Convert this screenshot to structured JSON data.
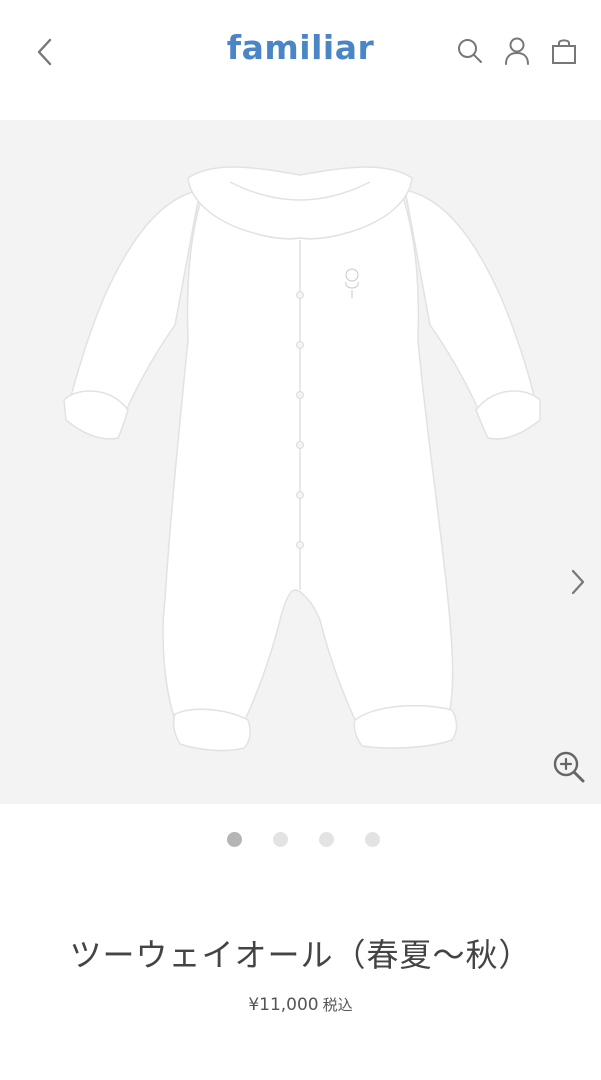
{
  "header": {
    "logo": "familiar",
    "icons": [
      "chevron-left-icon",
      "search-icon",
      "account-icon",
      "shopping-bag-icon"
    ]
  },
  "gallery": {
    "image_alt": "白いツーウェイオール",
    "slide_count": 4,
    "active_slide": 1,
    "icons": [
      "chevron-right-icon",
      "zoom-in-icon"
    ]
  },
  "product": {
    "title": "ツーウェイオール（春夏～秋）",
    "price": "¥11,000",
    "tax_label": "税込"
  },
  "colors": {
    "logo": "#4a86c5",
    "gallery_bg": "#f3f3f3",
    "dot_active": "#b5b5b5",
    "dot_inactive": "#e3e3e3",
    "icon": "#777777"
  }
}
